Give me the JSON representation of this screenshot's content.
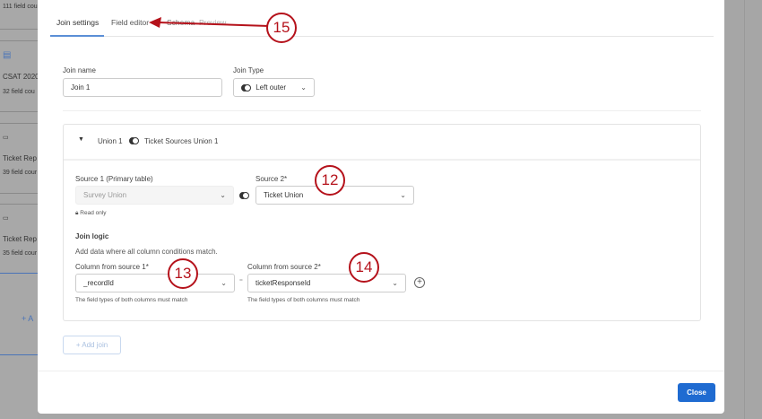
{
  "background": {
    "items": [
      {
        "count": "111 field cou"
      },
      {
        "name": "CSAT 2020",
        "count": "32 field cou"
      },
      {
        "name": "Ticket Rep",
        "count": "39 field cour"
      },
      {
        "name": "Ticket Rep",
        "count": "35 field cour"
      }
    ],
    "add_label": "+ A"
  },
  "tabs": [
    "Join settings",
    "Field editor",
    "Schema",
    "Preview"
  ],
  "join_name": {
    "label": "Join name",
    "value": "Join 1"
  },
  "join_type": {
    "label": "Join Type",
    "value": "Left outer"
  },
  "card": {
    "left": "Union 1",
    "right": "Ticket Sources Union 1",
    "source1": {
      "label": "Source 1 (Primary table)",
      "value": "Survey Union",
      "note": "Read only"
    },
    "source2": {
      "label": "Source 2*",
      "value": "Ticket Union"
    },
    "join_logic": {
      "title": "Join logic",
      "desc": "Add data where all column conditions match.",
      "col1": {
        "label": "Column from source 1*",
        "value": "_recordId",
        "hint": "The field types of both columns must match"
      },
      "eq": "=",
      "col2": {
        "label": "Column from source 2*",
        "value": "ticketResponseId",
        "hint": "The field types of both columns must match"
      }
    }
  },
  "add_join": "+ Add join",
  "close": "Close",
  "callouts": [
    "15",
    "12",
    "13",
    "14"
  ],
  "colors": {
    "accent": "#1f6bd1",
    "callout": "#b5121b"
  }
}
